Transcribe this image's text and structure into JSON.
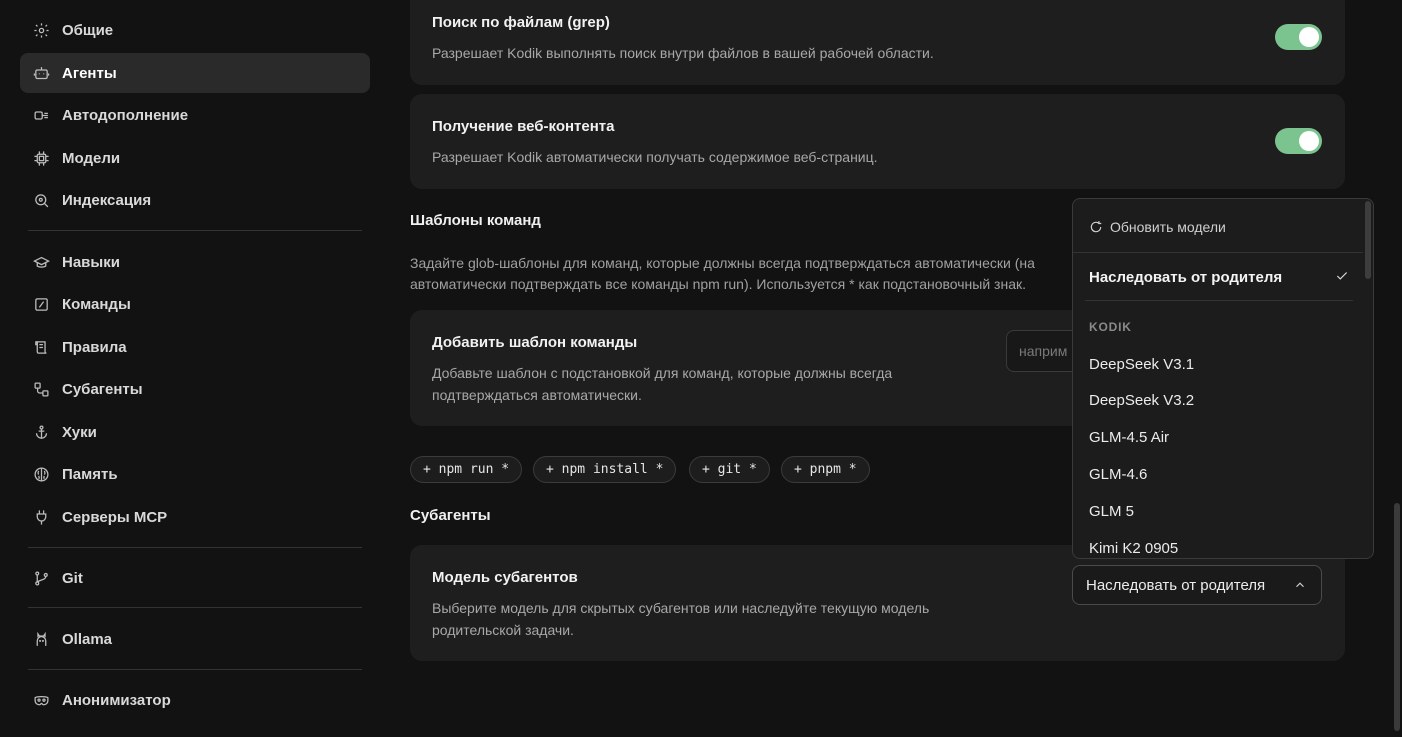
{
  "sidebar": {
    "items": [
      {
        "label": "Общие",
        "icon": "gear-icon"
      },
      {
        "label": "Агенты",
        "icon": "robot-icon",
        "active": true
      },
      {
        "label": "Автодополнение",
        "icon": "autocomplete-icon"
      },
      {
        "label": "Модели",
        "icon": "chip-icon"
      },
      {
        "label": "Индексация",
        "icon": "index-search-icon"
      },
      {
        "label": "Навыки",
        "icon": "graduation-cap-icon"
      },
      {
        "label": "Команды",
        "icon": "command-icon"
      },
      {
        "label": "Правила",
        "icon": "scroll-icon"
      },
      {
        "label": "Субагенты",
        "icon": "subagents-icon"
      },
      {
        "label": "Хуки",
        "icon": "anchor-icon"
      },
      {
        "label": "Память",
        "icon": "brain-icon"
      },
      {
        "label": "Серверы MCP",
        "icon": "plug-icon"
      },
      {
        "label": "Git",
        "icon": "git-branch-icon"
      },
      {
        "label": "Ollama",
        "icon": "ollama-icon"
      },
      {
        "label": "Анонимизатор",
        "icon": "mask-icon"
      }
    ]
  },
  "cards": {
    "grep": {
      "title": "Поиск по файлам (grep)",
      "description": "Разрешает Kodik выполнять поиск внутри файлов в вашей рабочей области.",
      "enabled": true
    },
    "web": {
      "title": "Получение веб-контента",
      "description": "Разрешает Kodik автоматически получать содержимое веб-страниц.",
      "enabled": true
    }
  },
  "command_patterns": {
    "section_title": "Шаблоны команд",
    "section_desc_line1": "Задайте glob-шаблоны для команд, которые должны всегда подтверждаться автоматически (на",
    "section_desc_line2": "автоматически подтверждать все команды npm run). Используется * как подстановочный знак.",
    "add_title": "Добавить шаблон команды",
    "add_desc_line1": "Добавьте шаблон с подстановкой для команд, которые должны всегда",
    "add_desc_line2": "подтверждаться автоматически.",
    "input_placeholder": "наприм",
    "chips": [
      "+ npm run *",
      "+ npm install *",
      "+ git *",
      "+ pnpm *"
    ]
  },
  "subagents": {
    "section_title": "Субагенты",
    "model_title": "Модель субагентов",
    "model_desc_line1": "Выберите модель для скрытых субагентов или наследуйте текущую модель",
    "model_desc_line2": "родительской задачи.",
    "selected_value": "Наследовать от родителя"
  },
  "dropdown": {
    "refresh_label": "Обновить модели",
    "selected_option": "Наследовать от родителя",
    "group_label": "KODIK",
    "options": [
      "DeepSeek V3.1",
      "DeepSeek V3.2",
      "GLM-4.5 Air",
      "GLM-4.6",
      "GLM 5",
      "Kimi K2 0905"
    ]
  },
  "colors": {
    "toggle_on": "#7cc48f",
    "background": "#121212",
    "card": "#1e1e1e"
  }
}
